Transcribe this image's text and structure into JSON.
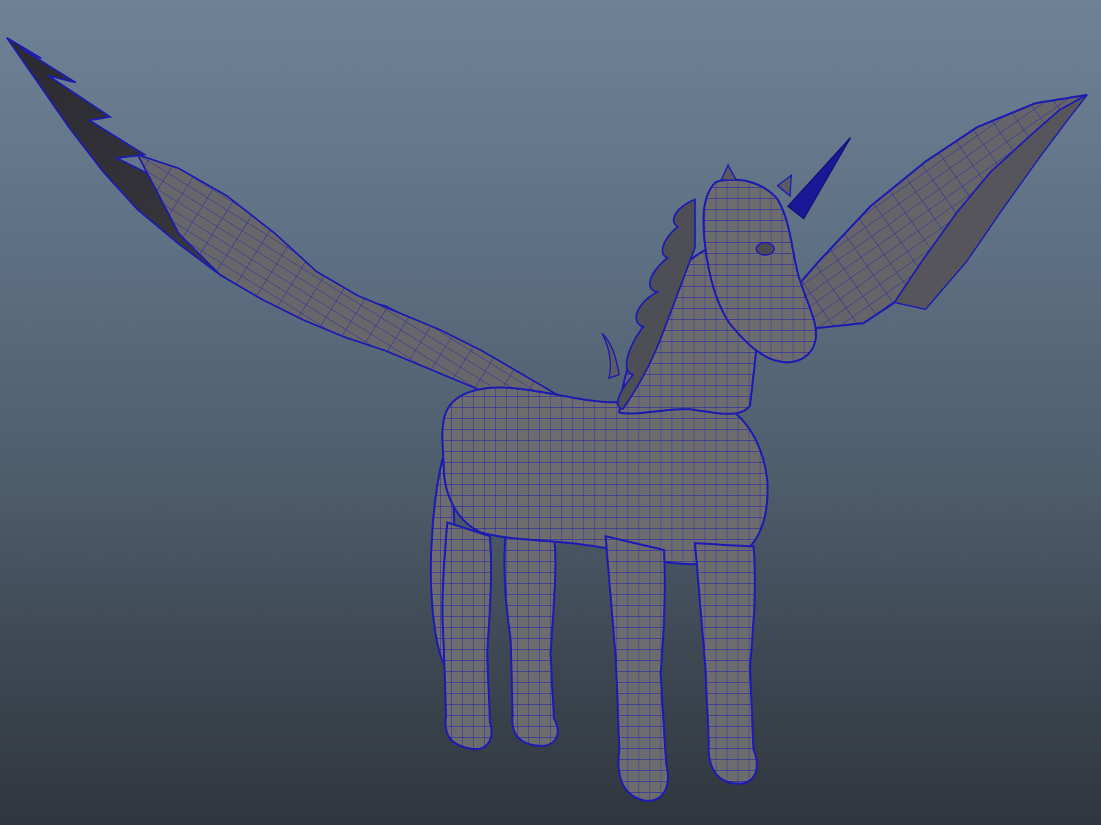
{
  "viewport": {
    "background_top": "#6e8296",
    "background_bottom": "#30363d"
  },
  "model": {
    "subject": "winged-unicorn",
    "shade_color": "#6c6c6f",
    "dark_shade_color": "#3a3a3e",
    "wireframe_color": "#1e1cb0",
    "horn_color": "#1a1896"
  }
}
